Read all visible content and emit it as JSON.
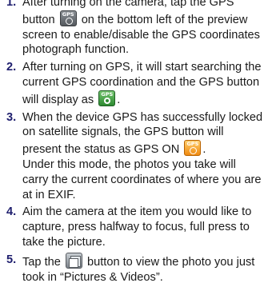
{
  "steps": [
    {
      "num": "1.",
      "before": "After turning on the camera, tap the GPS button ",
      "icon": "gps-off-icon",
      "after": " on the bottom left of the preview screen to enable/disable the GPS coordinates photograph function."
    },
    {
      "num": "2.",
      "before": "After turning on GPS, it will start searching the current GPS coordination and the GPS button will display as ",
      "icon": "gps-searching-icon",
      "after": "."
    },
    {
      "num": "3.",
      "before": "When the device GPS has successfully locked on satellite signals, the GPS button will present the status as GPS ON ",
      "icon": "gps-on-icon",
      "after": ".",
      "extra": "Under this mode, the photos you take will carry the current coordinates of where you are at in EXIF."
    },
    {
      "num": "4.",
      "text": "Aim the camera at the item you would like to capture, press halfway to focus, full press to take the picture."
    },
    {
      "num": "5.",
      "before": "Tap the ",
      "icon": "pictures-videos-icon",
      "after": " button to view the photo you just took in “Pictures & Videos”."
    }
  ],
  "icon_labels": {
    "gps": "GPS"
  },
  "colors": {
    "step_number": "#1e1e6e",
    "gps_off": "#555a5f",
    "gps_searching": "#2d8a31",
    "gps_on": "#f08a10"
  }
}
